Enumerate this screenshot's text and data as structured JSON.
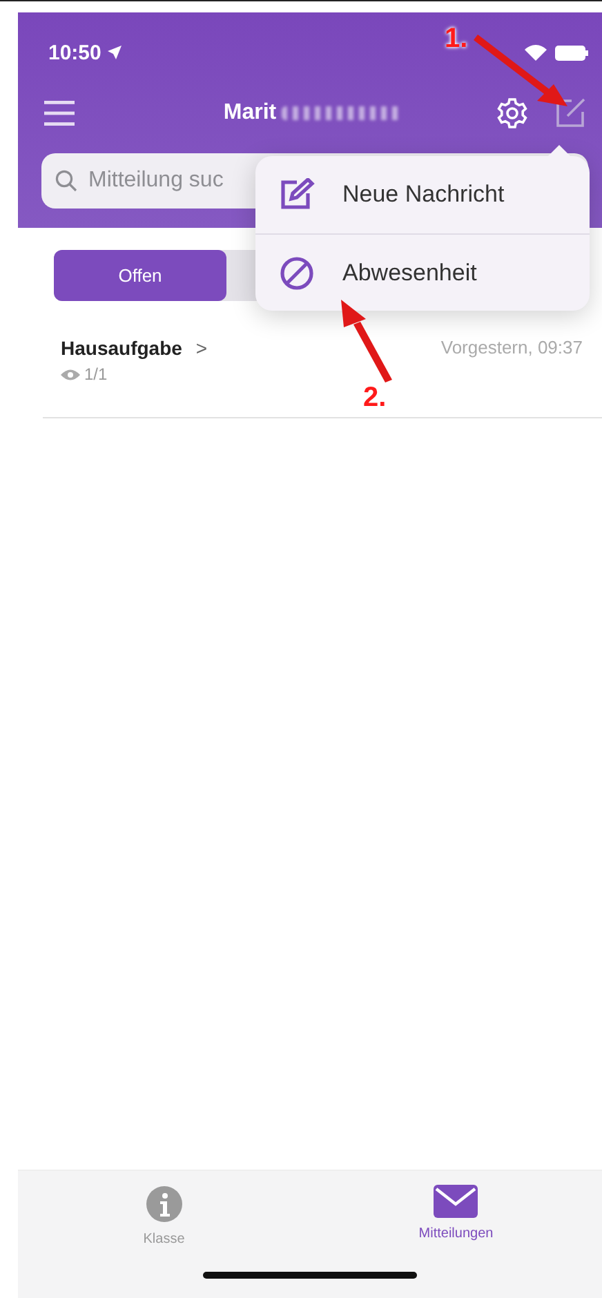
{
  "status_bar": {
    "time": "10:50"
  },
  "header": {
    "title": "Marit"
  },
  "search": {
    "placeholder": "Mitteilung suc"
  },
  "segments": [
    {
      "label": "Offen",
      "selected": true
    }
  ],
  "menu": {
    "items": [
      {
        "kind": "compose",
        "label": "Neue Nachricht"
      },
      {
        "kind": "absence",
        "label": "Abwesenheit"
      }
    ]
  },
  "messages": [
    {
      "title": "Hausaufgabe",
      "chevron": ">",
      "date": "Vorgestern, 09:37",
      "reads": "1/1"
    }
  ],
  "annotations": [
    {
      "label": "1."
    },
    {
      "label": "2."
    }
  ],
  "tab_bar": [
    {
      "kind": "info",
      "label": "Klasse",
      "selected": false
    },
    {
      "kind": "mail",
      "label": "Mitteilungen",
      "selected": true
    }
  ]
}
